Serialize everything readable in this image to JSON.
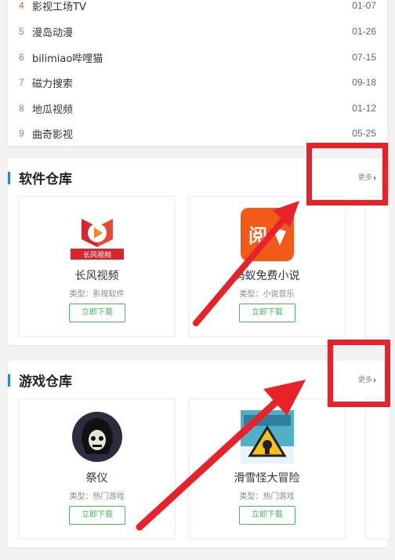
{
  "top_list": {
    "items": [
      {
        "num": "4",
        "name": "影视工场TV",
        "date": "01-07"
      },
      {
        "num": "5",
        "name": "漫岛动漫",
        "date": "01-26"
      },
      {
        "num": "6",
        "name": "bilimiao哔哩猫",
        "date": "07-15"
      },
      {
        "num": "7",
        "name": "磁力搜索",
        "date": "09-18"
      },
      {
        "num": "8",
        "name": "地瓜视频",
        "date": "01-12"
      },
      {
        "num": "9",
        "name": "曲奇影视",
        "date": "05-25"
      }
    ]
  },
  "software": {
    "title": "软件仓库",
    "more": "更多",
    "apps": [
      {
        "name": "长风视频",
        "type": "类型：影视软件",
        "button": "立即下载",
        "icon": "changfeng-video-icon",
        "icon_label": "长风视频"
      },
      {
        "name": "蚂蚁免费小说",
        "type": "类型：小说音乐",
        "button": "立即下载",
        "icon": "novel-app-icon",
        "icon_label": "阅"
      }
    ]
  },
  "games": {
    "title": "游戏仓库",
    "more": "更多",
    "apps": [
      {
        "name": "祭仪",
        "type": "类型：热门游戏",
        "button": "立即下载",
        "icon": "skull-hood-icon"
      },
      {
        "name": "滑雪怪大冒险",
        "type": "类型：热门游戏",
        "button": "立即下载",
        "icon": "ski-monster-icon"
      }
    ]
  },
  "colors": {
    "accent_blue": "#2a86db",
    "download_green": "#4cb464",
    "rank_orange": "#e56b3c",
    "annotation_red": "#e8222a"
  }
}
